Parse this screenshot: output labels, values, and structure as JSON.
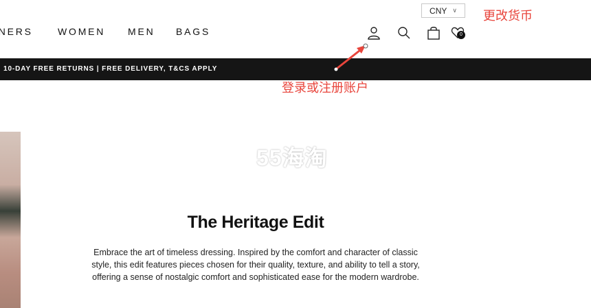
{
  "header": {
    "currency": {
      "value": "CNY"
    },
    "nav": [
      "GNERS",
      "WOMEN",
      "MEN",
      "BAGS"
    ],
    "wishlist_count": "0",
    "icons": [
      "account-icon",
      "search-icon",
      "bag-icon",
      "wishlist-icon"
    ]
  },
  "promo": {
    "text": "10-DAY FREE RETURNS | FREE DELIVERY, T&CS APPLY"
  },
  "annotations": {
    "currency": "更改货币",
    "login": "登录或注册账户",
    "color": "#e8453c"
  },
  "watermark": "55海淘",
  "hero": {
    "title": "The Heritage Edit",
    "description_lines": [
      "Embrace the art of timeless dressing. Inspired by the comfort and character of classic",
      "style, this edit features pieces chosen for their quality, texture, and ability to tell a story,",
      "offering a sense of nostalgic comfort and sophisticated ease for the modern wardrobe."
    ]
  },
  "colors": {
    "promo_bg": "#151515",
    "text": "#111111"
  }
}
